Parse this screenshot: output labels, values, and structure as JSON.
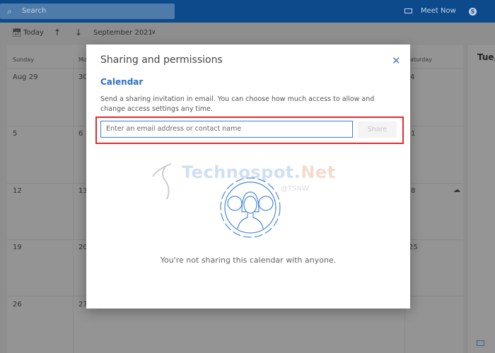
{
  "topbar": {
    "search_placeholder": "Search",
    "meet_now": "Meet Now",
    "skype_glyph": "S"
  },
  "toolbar": {
    "today": "Today",
    "month": "September 2021"
  },
  "calendar": {
    "day_names": [
      "Sunday",
      "Mo",
      "",
      "",
      "",
      "",
      "aturday"
    ],
    "rows": [
      {
        "sun": "Aug 29",
        "mon": "30",
        "sat": "4"
      },
      {
        "sun": "5",
        "mon": "6",
        "sat": "1"
      },
      {
        "sun": "12",
        "mon": "13",
        "sat": "8"
      },
      {
        "sun": "19",
        "mon": "20",
        "sat": "25"
      },
      {
        "sun": "26",
        "mon": "27",
        "sat": ""
      }
    ],
    "right_pane_title": "Tue, "
  },
  "dialog": {
    "title": "Sharing and permissions",
    "calendar_name": "Calendar",
    "description": "Send a sharing invitation in email. You can choose how much access to allow and change access settings any time.",
    "email_placeholder": "Enter an email address or contact name",
    "share_button": "Share",
    "empty_message": "You're not sharing this calendar with anyone.",
    "watermark": {
      "name": "Technospot.",
      "suffix": "Net",
      "handle": "@TSNW"
    }
  },
  "colors": {
    "header": "#0d4a8b",
    "accent": "#2b6fcb",
    "highlight": "#e32b2b"
  }
}
